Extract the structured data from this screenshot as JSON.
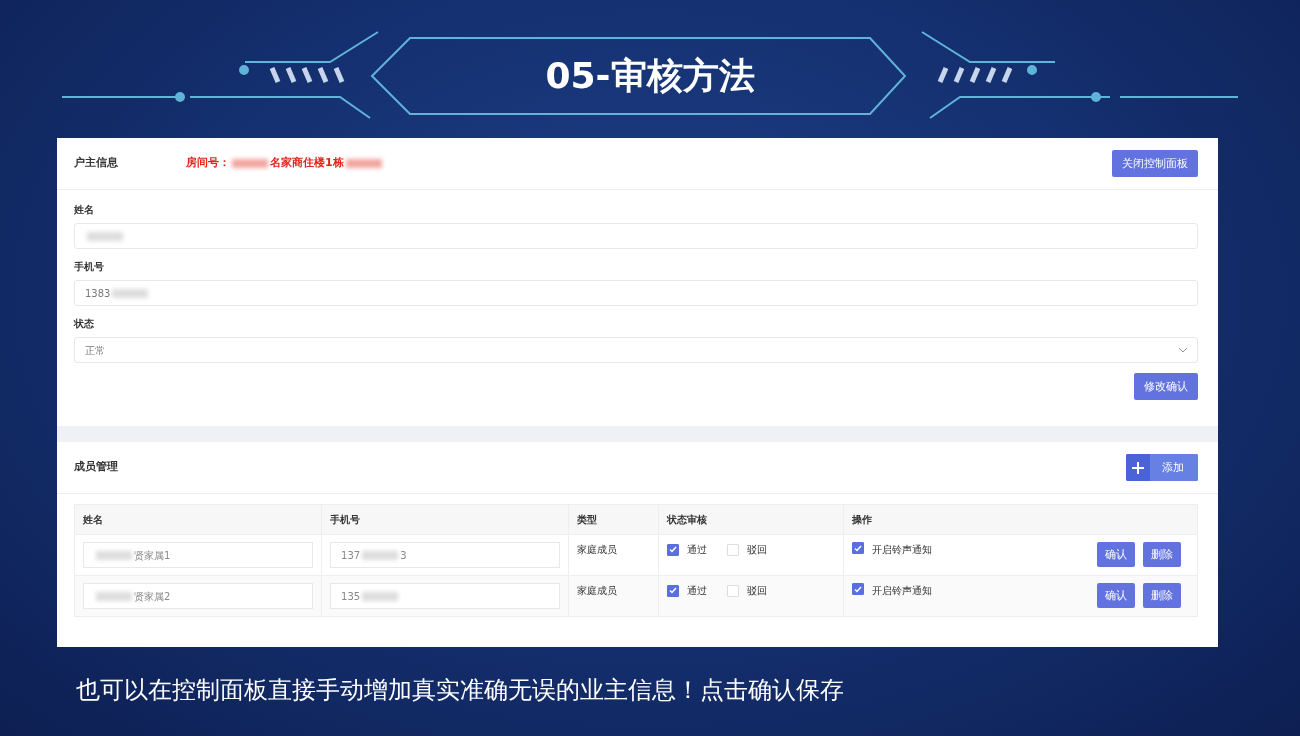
{
  "slide_title": "05-审核方法",
  "owner_panel": {
    "title": "户主信息",
    "room": [
      {
        "kind": "text",
        "text": "房间号："
      },
      {
        "kind": "blur"
      },
      {
        "kind": "text",
        "text": "名家商住楼1栋"
      },
      {
        "kind": "blur"
      }
    ],
    "close_button": "关闭控制面板",
    "fields": [
      {
        "kind": "input",
        "label": "姓名",
        "value": [
          {
            "kind": "blur"
          }
        ]
      },
      {
        "kind": "input",
        "label": "手机号",
        "value": [
          {
            "kind": "text",
            "text": "1383"
          },
          {
            "kind": "blur"
          }
        ]
      },
      {
        "kind": "select",
        "label": "状态",
        "value": [
          {
            "kind": "text",
            "text": "正常"
          }
        ]
      }
    ],
    "submit_button": "修改确认"
  },
  "members_panel": {
    "title": "成员管理",
    "add_button": "添加",
    "columns": [
      "姓名",
      "手机号",
      "类型",
      "状态审核",
      "操作"
    ],
    "rows": [
      {
        "name": [
          {
            "kind": "blur"
          },
          {
            "kind": "text",
            "text": "贤家属1"
          }
        ],
        "phone": [
          {
            "kind": "text",
            "text": "137"
          },
          {
            "kind": "blur"
          },
          {
            "kind": "text",
            "text": "3"
          }
        ],
        "type": "家庭成员",
        "pass_label": "通过",
        "pass_checked": true,
        "reject_label": "驳回",
        "reject_checked": false,
        "ring_label": "开启铃声通知",
        "ring_checked": true,
        "confirm": "确认",
        "delete": "删除"
      },
      {
        "name": [
          {
            "kind": "blur"
          },
          {
            "kind": "text",
            "text": "贤家属2"
          }
        ],
        "phone": [
          {
            "kind": "text",
            "text": "135"
          },
          {
            "kind": "blur"
          }
        ],
        "type": "家庭成员",
        "pass_label": "通过",
        "pass_checked": true,
        "reject_label": "驳回",
        "reject_checked": false,
        "ring_label": "开启铃声通知",
        "ring_checked": true,
        "confirm": "确认",
        "delete": "删除"
      }
    ]
  },
  "caption": "也可以在控制面板直接手动增加真实准确无误的业主信息！点击确认保存"
}
